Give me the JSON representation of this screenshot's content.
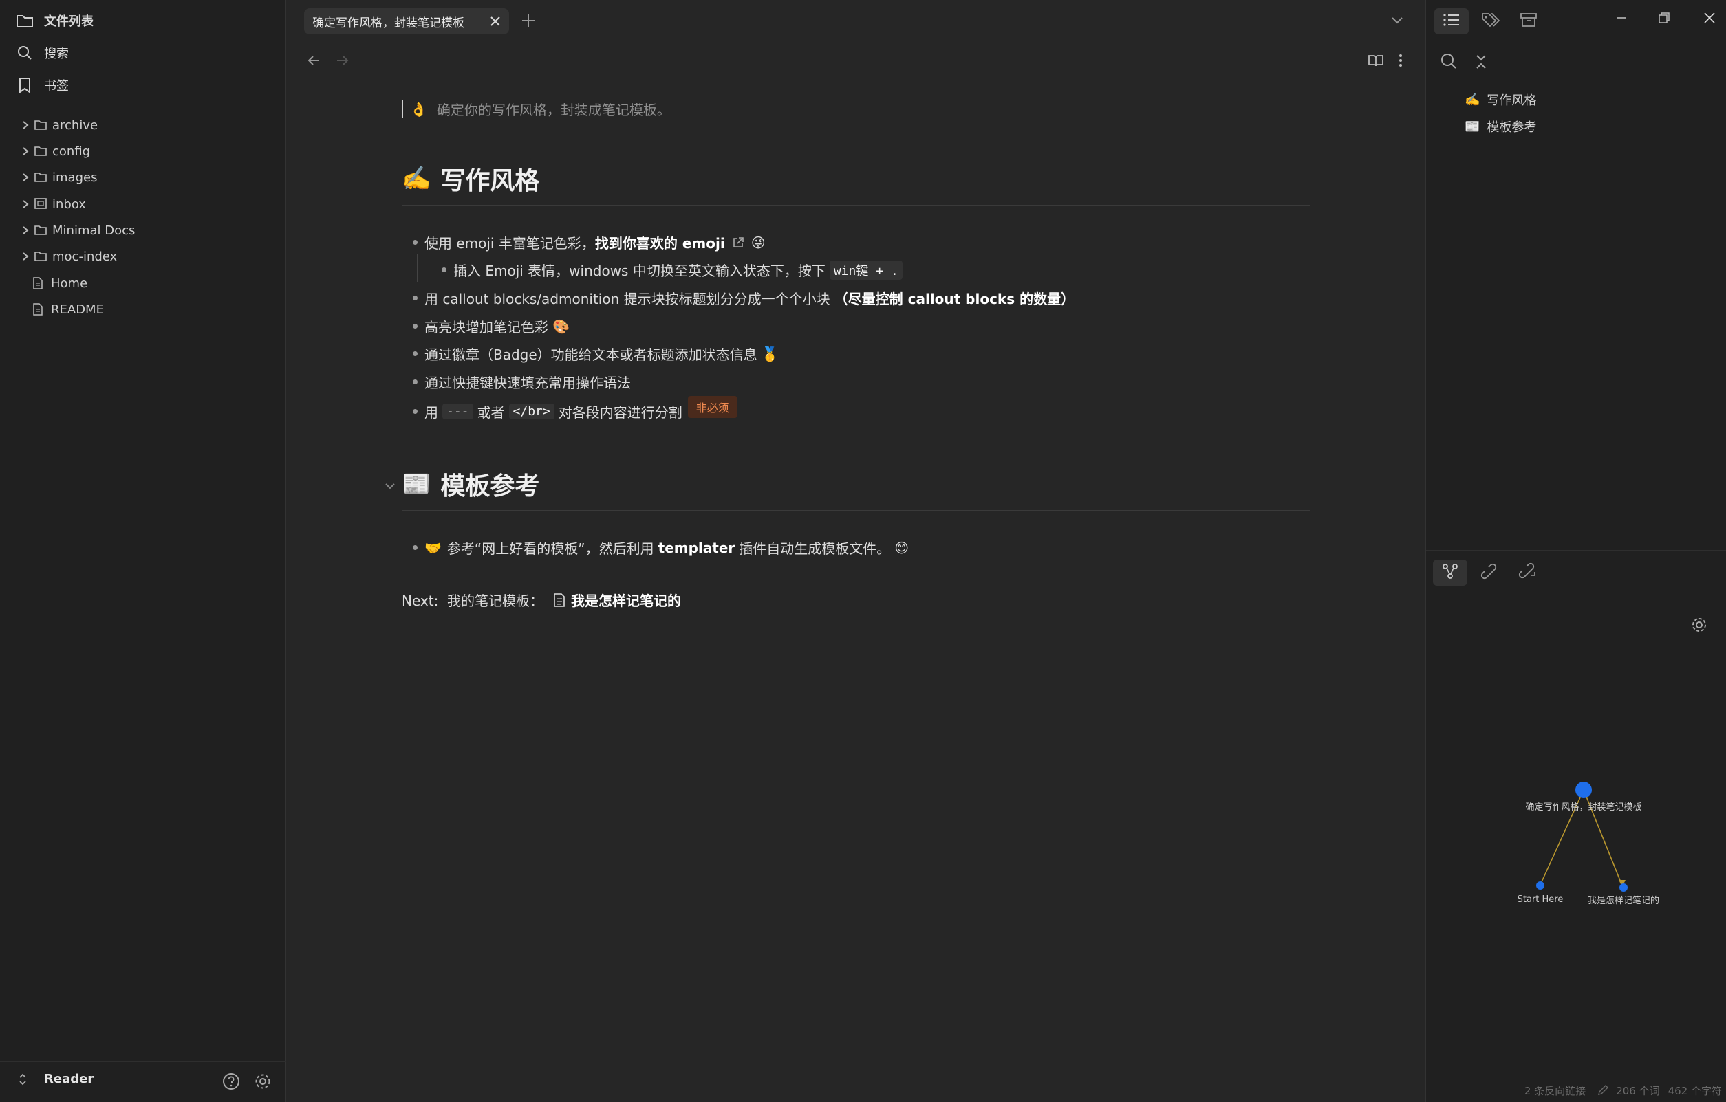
{
  "left_sidebar": {
    "nav": {
      "files": "文件列表",
      "search": "搜索",
      "bookmarks": "书签"
    },
    "tree": [
      {
        "label": "archive",
        "type": "folder"
      },
      {
        "label": "config",
        "type": "folder"
      },
      {
        "label": "images",
        "type": "folder"
      },
      {
        "label": "inbox",
        "type": "folder"
      },
      {
        "label": "Minimal Docs",
        "type": "folder"
      },
      {
        "label": "moc-index",
        "type": "folder"
      },
      {
        "label": "Home",
        "type": "file"
      },
      {
        "label": "README",
        "type": "file"
      }
    ],
    "vault_name": "Reader"
  },
  "tab": {
    "title": "确定写作风格，封装笔记模板"
  },
  "editor": {
    "intro": "确定你的写作风格，封装成笔记模板。",
    "intro_emoji": "👌",
    "section1": {
      "emoji": "✍️",
      "title": "写作风格",
      "b1_pre": "使用 emoji 丰富笔记色彩，",
      "b1_bold": "找到你喜欢的 emoji",
      "b1_emoji": "😜",
      "b1a_pre": "插入 Emoji 表情，windows 中切换至英文输入状态下，按下",
      "b1a_code": "win键 + .",
      "b2_pre": "用 callout blocks/admonition 提示块按标题划分分成一个个小块",
      "b2_bold": "（尽量控制 callout blocks 的数量）",
      "b3": "高亮块增加笔记色彩",
      "b3_emoji": "🎨",
      "b4": "通过徽章（Badge）功能给文本或者标题添加状态信息",
      "b4_emoji": "🥇",
      "b5": "通过快捷键快速填充常用操作语法",
      "b6_pre": "用",
      "b6_code1": "---",
      "b6_mid": "或者",
      "b6_code2": "</br>",
      "b6_post": "对各段内容进行分割",
      "b6_badge": "非必须"
    },
    "section2": {
      "emoji": "📰",
      "title": "模板参考",
      "b1_emoji": "🤝",
      "b1_pre": "参考“网上好看的模板”，然后利用",
      "b1_bold": "templater",
      "b1_post": "插件自动生成模板文件。",
      "b1_end_emoji": "😊"
    },
    "next_label": "Next:  我的笔记模板：",
    "next_link": "我是怎样记笔记的"
  },
  "right_sidebar": {
    "outline": [
      {
        "emoji": "✍️",
        "label": "写作风格"
      },
      {
        "emoji": "📰",
        "label": "模板参考"
      }
    ],
    "graph": {
      "center": "确定写作风格，封装笔记模板",
      "left": "Start Here",
      "right": "我是怎样记笔记的"
    }
  },
  "status": {
    "backlinks": "2 条反向链接",
    "words": "206 个词",
    "chars": "462 个字符"
  },
  "colors": {
    "accent": "#1f6feb",
    "badge_text": "#f08a50",
    "badge_bg": "#4a2a1c",
    "edge": "#b8962e"
  }
}
